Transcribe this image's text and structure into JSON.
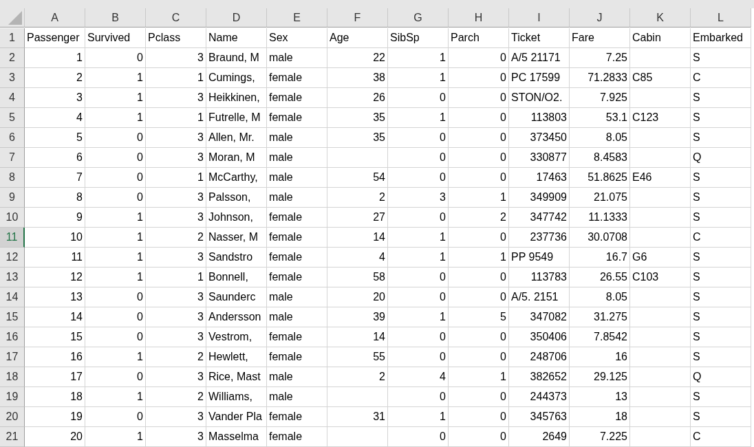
{
  "columns": [
    {
      "letter": "A",
      "selected": false
    },
    {
      "letter": "B",
      "selected": false
    },
    {
      "letter": "C",
      "selected": false
    },
    {
      "letter": "D",
      "selected": false
    },
    {
      "letter": "E",
      "selected": false
    },
    {
      "letter": "F",
      "selected": false
    },
    {
      "letter": "G",
      "selected": false
    },
    {
      "letter": "H",
      "selected": false
    },
    {
      "letter": "I",
      "selected": false
    },
    {
      "letter": "J",
      "selected": false
    },
    {
      "letter": "K",
      "selected": false
    },
    {
      "letter": "L",
      "selected": false
    }
  ],
  "rows": [
    {
      "number": "1",
      "selected": false,
      "cells": [
        {
          "text": "Passenger",
          "kind": "text"
        },
        {
          "text": "Survived",
          "kind": "text"
        },
        {
          "text": "Pclass",
          "kind": "text"
        },
        {
          "text": "Name",
          "kind": "text"
        },
        {
          "text": "Sex",
          "kind": "text"
        },
        {
          "text": "Age",
          "kind": "text"
        },
        {
          "text": "SibSp",
          "kind": "text"
        },
        {
          "text": "Parch",
          "kind": "text"
        },
        {
          "text": "Ticket",
          "kind": "text"
        },
        {
          "text": "Fare",
          "kind": "text"
        },
        {
          "text": "Cabin",
          "kind": "text"
        },
        {
          "text": "Embarked",
          "kind": "text"
        }
      ]
    },
    {
      "number": "2",
      "selected": false,
      "cells": [
        {
          "text": "1",
          "kind": "number"
        },
        {
          "text": "0",
          "kind": "number"
        },
        {
          "text": "3",
          "kind": "number"
        },
        {
          "text": "Braund, M",
          "kind": "text"
        },
        {
          "text": "male",
          "kind": "text"
        },
        {
          "text": "22",
          "kind": "number"
        },
        {
          "text": "1",
          "kind": "number"
        },
        {
          "text": "0",
          "kind": "number"
        },
        {
          "text": "A/5 21171",
          "kind": "text"
        },
        {
          "text": "7.25",
          "kind": "number"
        },
        null,
        {
          "text": "S",
          "kind": "text"
        }
      ]
    },
    {
      "number": "3",
      "selected": false,
      "cells": [
        {
          "text": "2",
          "kind": "number"
        },
        {
          "text": "1",
          "kind": "number"
        },
        {
          "text": "1",
          "kind": "number"
        },
        {
          "text": "Cumings,",
          "kind": "text"
        },
        {
          "text": "female",
          "kind": "text"
        },
        {
          "text": "38",
          "kind": "number"
        },
        {
          "text": "1",
          "kind": "number"
        },
        {
          "text": "0",
          "kind": "number"
        },
        {
          "text": "PC 17599",
          "kind": "text"
        },
        {
          "text": "71.2833",
          "kind": "number"
        },
        {
          "text": "C85",
          "kind": "text"
        },
        {
          "text": "C",
          "kind": "text"
        }
      ]
    },
    {
      "number": "4",
      "selected": false,
      "cells": [
        {
          "text": "3",
          "kind": "number"
        },
        {
          "text": "1",
          "kind": "number"
        },
        {
          "text": "3",
          "kind": "number"
        },
        {
          "text": "Heikkinen,",
          "kind": "text"
        },
        {
          "text": "female",
          "kind": "text"
        },
        {
          "text": "26",
          "kind": "number"
        },
        {
          "text": "0",
          "kind": "number"
        },
        {
          "text": "0",
          "kind": "number"
        },
        {
          "text": "STON/O2.",
          "kind": "text"
        },
        {
          "text": "7.925",
          "kind": "number"
        },
        null,
        {
          "text": "S",
          "kind": "text"
        }
      ]
    },
    {
      "number": "5",
      "selected": false,
      "cells": [
        {
          "text": "4",
          "kind": "number"
        },
        {
          "text": "1",
          "kind": "number"
        },
        {
          "text": "1",
          "kind": "number"
        },
        {
          "text": "Futrelle, M",
          "kind": "text"
        },
        {
          "text": "female",
          "kind": "text"
        },
        {
          "text": "35",
          "kind": "number"
        },
        {
          "text": "1",
          "kind": "number"
        },
        {
          "text": "0",
          "kind": "number"
        },
        {
          "text": "113803",
          "kind": "number"
        },
        {
          "text": "53.1",
          "kind": "number"
        },
        {
          "text": "C123",
          "kind": "text"
        },
        {
          "text": "S",
          "kind": "text"
        }
      ]
    },
    {
      "number": "6",
      "selected": false,
      "cells": [
        {
          "text": "5",
          "kind": "number"
        },
        {
          "text": "0",
          "kind": "number"
        },
        {
          "text": "3",
          "kind": "number"
        },
        {
          "text": "Allen, Mr.",
          "kind": "text"
        },
        {
          "text": "male",
          "kind": "text"
        },
        {
          "text": "35",
          "kind": "number"
        },
        {
          "text": "0",
          "kind": "number"
        },
        {
          "text": "0",
          "kind": "number"
        },
        {
          "text": "373450",
          "kind": "number"
        },
        {
          "text": "8.05",
          "kind": "number"
        },
        null,
        {
          "text": "S",
          "kind": "text"
        }
      ]
    },
    {
      "number": "7",
      "selected": false,
      "cells": [
        {
          "text": "6",
          "kind": "number"
        },
        {
          "text": "0",
          "kind": "number"
        },
        {
          "text": "3",
          "kind": "number"
        },
        {
          "text": "Moran, M",
          "kind": "text"
        },
        {
          "text": "male",
          "kind": "text"
        },
        null,
        {
          "text": "0",
          "kind": "number"
        },
        {
          "text": "0",
          "kind": "number"
        },
        {
          "text": "330877",
          "kind": "number"
        },
        {
          "text": "8.4583",
          "kind": "number"
        },
        null,
        {
          "text": "Q",
          "kind": "text"
        }
      ]
    },
    {
      "number": "8",
      "selected": false,
      "cells": [
        {
          "text": "7",
          "kind": "number"
        },
        {
          "text": "0",
          "kind": "number"
        },
        {
          "text": "1",
          "kind": "number"
        },
        {
          "text": "McCarthy,",
          "kind": "text"
        },
        {
          "text": "male",
          "kind": "text"
        },
        {
          "text": "54",
          "kind": "number"
        },
        {
          "text": "0",
          "kind": "number"
        },
        {
          "text": "0",
          "kind": "number"
        },
        {
          "text": "17463",
          "kind": "number"
        },
        {
          "text": "51.8625",
          "kind": "number"
        },
        {
          "text": "E46",
          "kind": "text"
        },
        {
          "text": "S",
          "kind": "text"
        }
      ]
    },
    {
      "number": "9",
      "selected": false,
      "cells": [
        {
          "text": "8",
          "kind": "number"
        },
        {
          "text": "0",
          "kind": "number"
        },
        {
          "text": "3",
          "kind": "number"
        },
        {
          "text": "Palsson,",
          "kind": "text"
        },
        {
          "text": "male",
          "kind": "text"
        },
        {
          "text": "2",
          "kind": "number"
        },
        {
          "text": "3",
          "kind": "number"
        },
        {
          "text": "1",
          "kind": "number"
        },
        {
          "text": "349909",
          "kind": "number"
        },
        {
          "text": "21.075",
          "kind": "number"
        },
        null,
        {
          "text": "S",
          "kind": "text"
        }
      ]
    },
    {
      "number": "10",
      "selected": false,
      "cells": [
        {
          "text": "9",
          "kind": "number"
        },
        {
          "text": "1",
          "kind": "number"
        },
        {
          "text": "3",
          "kind": "number"
        },
        {
          "text": "Johnson,",
          "kind": "text"
        },
        {
          "text": "female",
          "kind": "text"
        },
        {
          "text": "27",
          "kind": "number"
        },
        {
          "text": "0",
          "kind": "number"
        },
        {
          "text": "2",
          "kind": "number"
        },
        {
          "text": "347742",
          "kind": "number"
        },
        {
          "text": "11.1333",
          "kind": "number"
        },
        null,
        {
          "text": "S",
          "kind": "text"
        }
      ]
    },
    {
      "number": "11",
      "selected": true,
      "cells": [
        {
          "text": "10",
          "kind": "number"
        },
        {
          "text": "1",
          "kind": "number"
        },
        {
          "text": "2",
          "kind": "number"
        },
        {
          "text": "Nasser, M",
          "kind": "text"
        },
        {
          "text": "female",
          "kind": "text"
        },
        {
          "text": "14",
          "kind": "number"
        },
        {
          "text": "1",
          "kind": "number"
        },
        {
          "text": "0",
          "kind": "number"
        },
        {
          "text": "237736",
          "kind": "number"
        },
        {
          "text": "30.0708",
          "kind": "number"
        },
        null,
        {
          "text": "C",
          "kind": "text"
        }
      ]
    },
    {
      "number": "12",
      "selected": false,
      "cells": [
        {
          "text": "11",
          "kind": "number"
        },
        {
          "text": "1",
          "kind": "number"
        },
        {
          "text": "3",
          "kind": "number"
        },
        {
          "text": "Sandstro",
          "kind": "text"
        },
        {
          "text": "female",
          "kind": "text"
        },
        {
          "text": "4",
          "kind": "number"
        },
        {
          "text": "1",
          "kind": "number"
        },
        {
          "text": "1",
          "kind": "number"
        },
        {
          "text": "PP 9549",
          "kind": "text"
        },
        {
          "text": "16.7",
          "kind": "number"
        },
        {
          "text": "G6",
          "kind": "text"
        },
        {
          "text": "S",
          "kind": "text"
        }
      ]
    },
    {
      "number": "13",
      "selected": false,
      "cells": [
        {
          "text": "12",
          "kind": "number"
        },
        {
          "text": "1",
          "kind": "number"
        },
        {
          "text": "1",
          "kind": "number"
        },
        {
          "text": "Bonnell,",
          "kind": "text"
        },
        {
          "text": "female",
          "kind": "text"
        },
        {
          "text": "58",
          "kind": "number"
        },
        {
          "text": "0",
          "kind": "number"
        },
        {
          "text": "0",
          "kind": "number"
        },
        {
          "text": "113783",
          "kind": "number"
        },
        {
          "text": "26.55",
          "kind": "number"
        },
        {
          "text": "C103",
          "kind": "text"
        },
        {
          "text": "S",
          "kind": "text"
        }
      ]
    },
    {
      "number": "14",
      "selected": false,
      "cells": [
        {
          "text": "13",
          "kind": "number"
        },
        {
          "text": "0",
          "kind": "number"
        },
        {
          "text": "3",
          "kind": "number"
        },
        {
          "text": "Saunderc",
          "kind": "text"
        },
        {
          "text": "male",
          "kind": "text"
        },
        {
          "text": "20",
          "kind": "number"
        },
        {
          "text": "0",
          "kind": "number"
        },
        {
          "text": "0",
          "kind": "number"
        },
        {
          "text": "A/5. 2151",
          "kind": "text"
        },
        {
          "text": "8.05",
          "kind": "number"
        },
        null,
        {
          "text": "S",
          "kind": "text"
        }
      ]
    },
    {
      "number": "15",
      "selected": false,
      "cells": [
        {
          "text": "14",
          "kind": "number"
        },
        {
          "text": "0",
          "kind": "number"
        },
        {
          "text": "3",
          "kind": "number"
        },
        {
          "text": "Andersson",
          "kind": "text"
        },
        {
          "text": "male",
          "kind": "text"
        },
        {
          "text": "39",
          "kind": "number"
        },
        {
          "text": "1",
          "kind": "number"
        },
        {
          "text": "5",
          "kind": "number"
        },
        {
          "text": "347082",
          "kind": "number"
        },
        {
          "text": "31.275",
          "kind": "number"
        },
        null,
        {
          "text": "S",
          "kind": "text"
        }
      ]
    },
    {
      "number": "16",
      "selected": false,
      "cells": [
        {
          "text": "15",
          "kind": "number"
        },
        {
          "text": "0",
          "kind": "number"
        },
        {
          "text": "3",
          "kind": "number"
        },
        {
          "text": "Vestrom,",
          "kind": "text"
        },
        {
          "text": "female",
          "kind": "text"
        },
        {
          "text": "14",
          "kind": "number"
        },
        {
          "text": "0",
          "kind": "number"
        },
        {
          "text": "0",
          "kind": "number"
        },
        {
          "text": "350406",
          "kind": "number"
        },
        {
          "text": "7.8542",
          "kind": "number"
        },
        null,
        {
          "text": "S",
          "kind": "text"
        }
      ]
    },
    {
      "number": "17",
      "selected": false,
      "cells": [
        {
          "text": "16",
          "kind": "number"
        },
        {
          "text": "1",
          "kind": "number"
        },
        {
          "text": "2",
          "kind": "number"
        },
        {
          "text": "Hewlett,",
          "kind": "text"
        },
        {
          "text": "female",
          "kind": "text"
        },
        {
          "text": "55",
          "kind": "number"
        },
        {
          "text": "0",
          "kind": "number"
        },
        {
          "text": "0",
          "kind": "number"
        },
        {
          "text": "248706",
          "kind": "number"
        },
        {
          "text": "16",
          "kind": "number"
        },
        null,
        {
          "text": "S",
          "kind": "text"
        }
      ]
    },
    {
      "number": "18",
      "selected": false,
      "cells": [
        {
          "text": "17",
          "kind": "number"
        },
        {
          "text": "0",
          "kind": "number"
        },
        {
          "text": "3",
          "kind": "number"
        },
        {
          "text": "Rice, Mast",
          "kind": "text"
        },
        {
          "text": "male",
          "kind": "text"
        },
        {
          "text": "2",
          "kind": "number"
        },
        {
          "text": "4",
          "kind": "number"
        },
        {
          "text": "1",
          "kind": "number"
        },
        {
          "text": "382652",
          "kind": "number"
        },
        {
          "text": "29.125",
          "kind": "number"
        },
        null,
        {
          "text": "Q",
          "kind": "text"
        }
      ]
    },
    {
      "number": "19",
      "selected": false,
      "cells": [
        {
          "text": "18",
          "kind": "number"
        },
        {
          "text": "1",
          "kind": "number"
        },
        {
          "text": "2",
          "kind": "number"
        },
        {
          "text": "Williams,",
          "kind": "text"
        },
        {
          "text": "male",
          "kind": "text"
        },
        null,
        {
          "text": "0",
          "kind": "number"
        },
        {
          "text": "0",
          "kind": "number"
        },
        {
          "text": "244373",
          "kind": "number"
        },
        {
          "text": "13",
          "kind": "number"
        },
        null,
        {
          "text": "S",
          "kind": "text"
        }
      ]
    },
    {
      "number": "20",
      "selected": false,
      "cells": [
        {
          "text": "19",
          "kind": "number"
        },
        {
          "text": "0",
          "kind": "number"
        },
        {
          "text": "3",
          "kind": "number"
        },
        {
          "text": "Vander Pla",
          "kind": "text"
        },
        {
          "text": "female",
          "kind": "text"
        },
        {
          "text": "31",
          "kind": "number"
        },
        {
          "text": "1",
          "kind": "number"
        },
        {
          "text": "0",
          "kind": "number"
        },
        {
          "text": "345763",
          "kind": "number"
        },
        {
          "text": "18",
          "kind": "number"
        },
        null,
        {
          "text": "S",
          "kind": "text"
        }
      ]
    },
    {
      "number": "21",
      "selected": false,
      "cells": [
        {
          "text": "20",
          "kind": "number"
        },
        {
          "text": "1",
          "kind": "number"
        },
        {
          "text": "3",
          "kind": "number"
        },
        {
          "text": "Masselma",
          "kind": "text"
        },
        {
          "text": "female",
          "kind": "text"
        },
        null,
        {
          "text": "0",
          "kind": "number"
        },
        {
          "text": "0",
          "kind": "number"
        },
        {
          "text": "2649",
          "kind": "number"
        },
        {
          "text": "7.225",
          "kind": "number"
        },
        null,
        {
          "text": "C",
          "kind": "text"
        }
      ]
    }
  ]
}
